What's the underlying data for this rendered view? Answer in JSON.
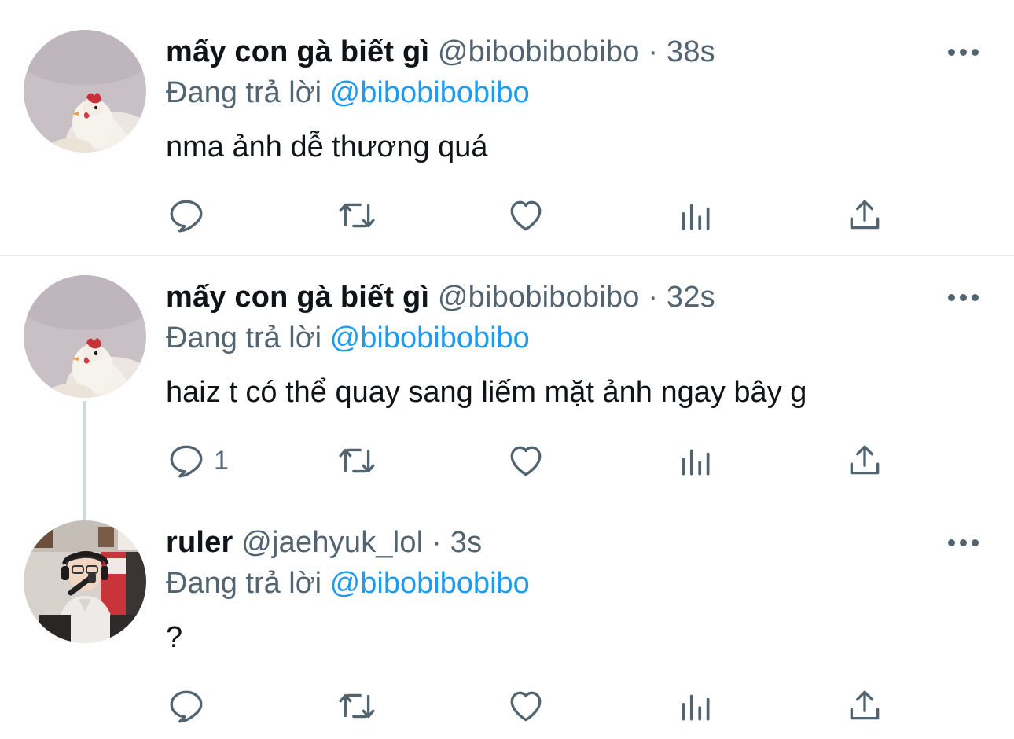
{
  "reply_prefix": "Đang trả lời",
  "colors": {
    "text": "#0f1419",
    "secondary": "#536471",
    "accent": "#1d9bf0",
    "divider": "#e7e9ea"
  },
  "tweets": [
    {
      "display_name": "mấy con gà biết gì",
      "handle": "@bibobibobibo",
      "separator": "·",
      "time": "38s",
      "reply_to": "@bibobibobibo",
      "text": "nma ảnh dễ thương quá",
      "reply_count": "",
      "avatar": "chicken-avatar"
    },
    {
      "display_name": "mấy con gà biết gì",
      "handle": "@bibobibobibo",
      "separator": "·",
      "time": "32s",
      "reply_to": "@bibobibobibo",
      "text": "haiz t có thể quay sang liếm mặt ảnh ngay bây g",
      "reply_count": "1",
      "avatar": "chicken-avatar"
    },
    {
      "display_name": "ruler",
      "handle": "@jaehyuk_lol",
      "separator": "·",
      "time": "3s",
      "reply_to": "@bibobibobibo",
      "text": "?",
      "reply_count": "",
      "avatar": "streamer-avatar"
    }
  ],
  "action_icons": [
    "reply-icon",
    "retweet-icon",
    "like-icon",
    "analytics-icon",
    "share-icon",
    "more-icon"
  ]
}
